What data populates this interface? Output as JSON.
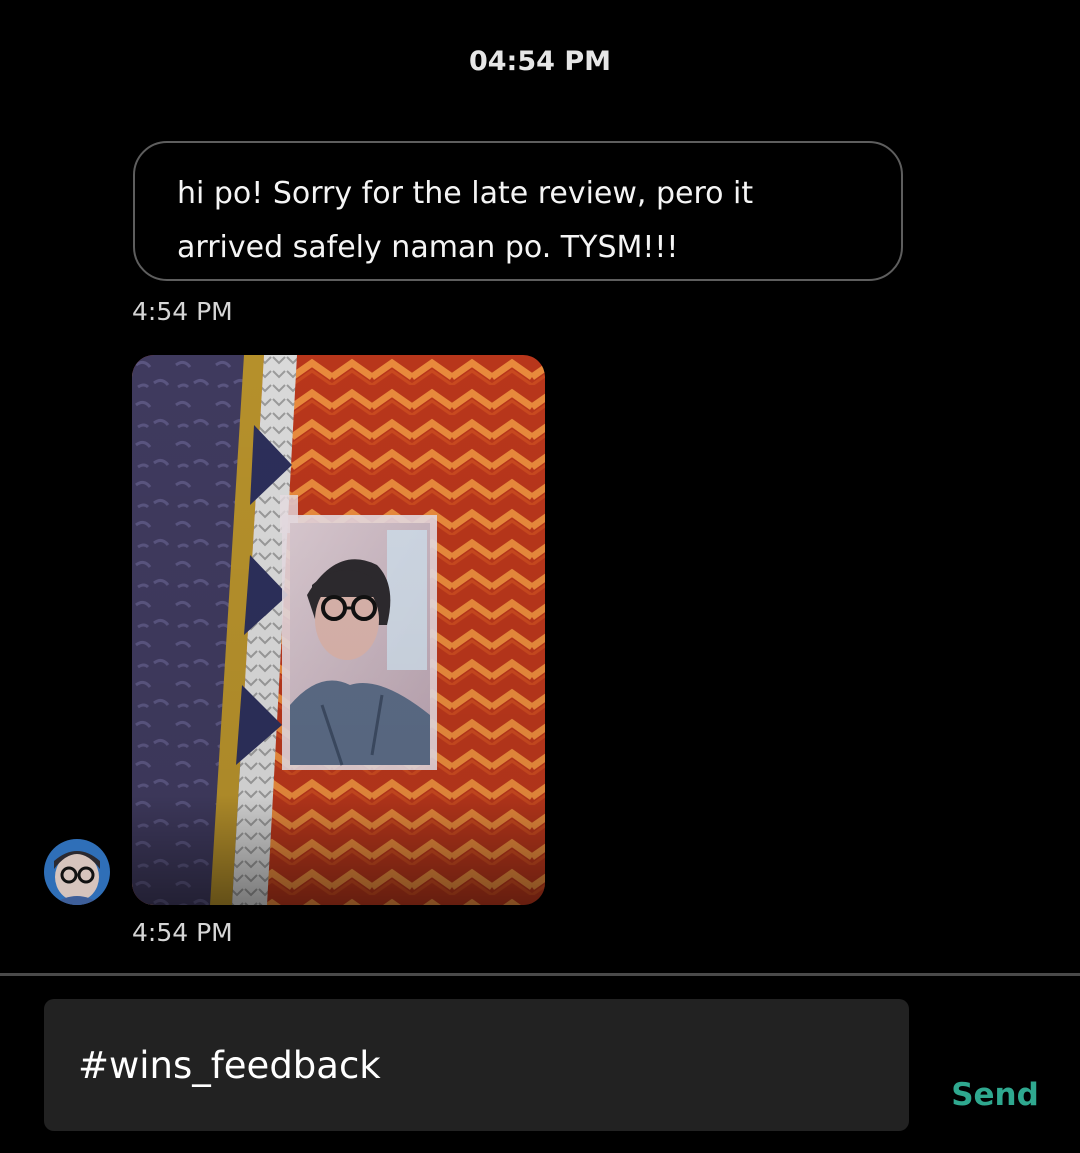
{
  "chat": {
    "date_header": "04:54 PM",
    "messages": [
      {
        "type": "text",
        "line1": "hi po! Sorry for the late review, pero it",
        "line2": "arrived safely naman po. TYSM!!!",
        "time": "4:54 PM"
      },
      {
        "type": "image",
        "description": "photocard-on-blanket",
        "time": "4:54 PM"
      }
    ]
  },
  "composer": {
    "input_value": "#wins_feedback",
    "send_label": "Send"
  },
  "colors": {
    "background": "#000000",
    "bubble_border": "#5e5e5e",
    "input_background": "#222222",
    "send_accent": "#2fa88f",
    "divider": "#4a4a4a"
  },
  "icons": {
    "avatar": "user-avatar"
  }
}
